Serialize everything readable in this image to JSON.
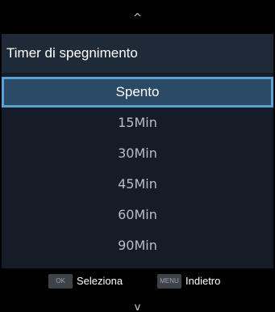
{
  "nav": {
    "up_arrow": "^",
    "down_arrow": "v"
  },
  "dialog": {
    "title": "Timer di spegnimento",
    "options": [
      "Spento",
      "15Min",
      "30Min",
      "45Min",
      "60Min",
      "90Min"
    ],
    "selected_option": "Spento"
  },
  "footer": {
    "ok_key": "OK",
    "ok_label": "Seleziona",
    "menu_key": "MENU",
    "menu_label": "Indietro"
  },
  "colors": {
    "panel_background": "#131c27",
    "header_background": "#1e2a38",
    "selected_background": "#2a4a66",
    "selected_outline": "#5aa2d6",
    "option_text": "#b7bec8"
  }
}
